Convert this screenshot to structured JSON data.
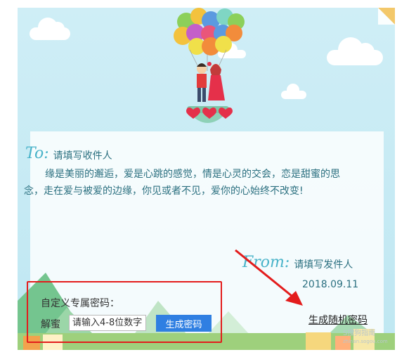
{
  "card": {
    "to_label": "To:",
    "recipient_placeholder": "请填写收件人",
    "message": "缘是美丽的邂逅，爱是心跳的感觉，情是心灵的交会，恋是甜蜜的思念，走在爱与被爱的边缘，你见或者不见，爱你的心始终不改变!",
    "from_label": "From:",
    "sender_placeholder": "请填写发件人",
    "date": "2018.09.11"
  },
  "password": {
    "title": "自定义专属密码：",
    "label": "解蜜",
    "input_placeholder": "请输入4-8位数字",
    "generate_button": "生成密码",
    "random_link": "生成随机密码"
  },
  "watermark": {
    "brand": "S搜狗指南",
    "url": "zhinan.sogou.com"
  },
  "colors": {
    "script_accent": "#49b3c9",
    "text_teal": "#2a6f7f",
    "button_blue": "#2f7fe2",
    "annotation_red": "#e31c1c"
  },
  "icons": [
    "hot-air-balloon",
    "heart-icon",
    "cloud",
    "red-arrow-annotation"
  ]
}
